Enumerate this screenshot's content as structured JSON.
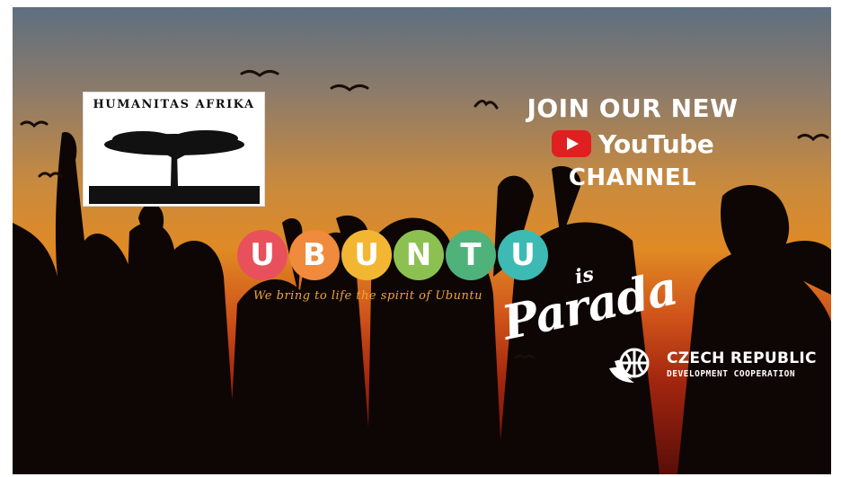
{
  "logo": {
    "title": "HUMANITAS AFRIKA"
  },
  "youtube": {
    "line1": "JOIN OUR NEW",
    "brand": "YouTube",
    "line3": "CHANNEL"
  },
  "ubuntu": {
    "letters": [
      "U",
      "B",
      "U",
      "N",
      "T",
      "U"
    ],
    "tagline": "We bring to life the spirit of Ubuntu"
  },
  "parada": {
    "is": "is",
    "word": "Parada"
  },
  "czech": {
    "title": "CZECH REPUBLIC",
    "subtitle": "DEVELOPMENT COOPERATION"
  },
  "colors": {
    "youtube_red": "#e02020",
    "ubuntu_circles": [
      "#e8505b",
      "#f08a3c",
      "#f2b632",
      "#8cc152",
      "#4fb27a",
      "#3dbab4"
    ],
    "tagline": "#f2a43a"
  },
  "icons": [
    "youtube-play-icon",
    "acacia-tree-icon",
    "globe-hands-icon",
    "bird-icon"
  ]
}
